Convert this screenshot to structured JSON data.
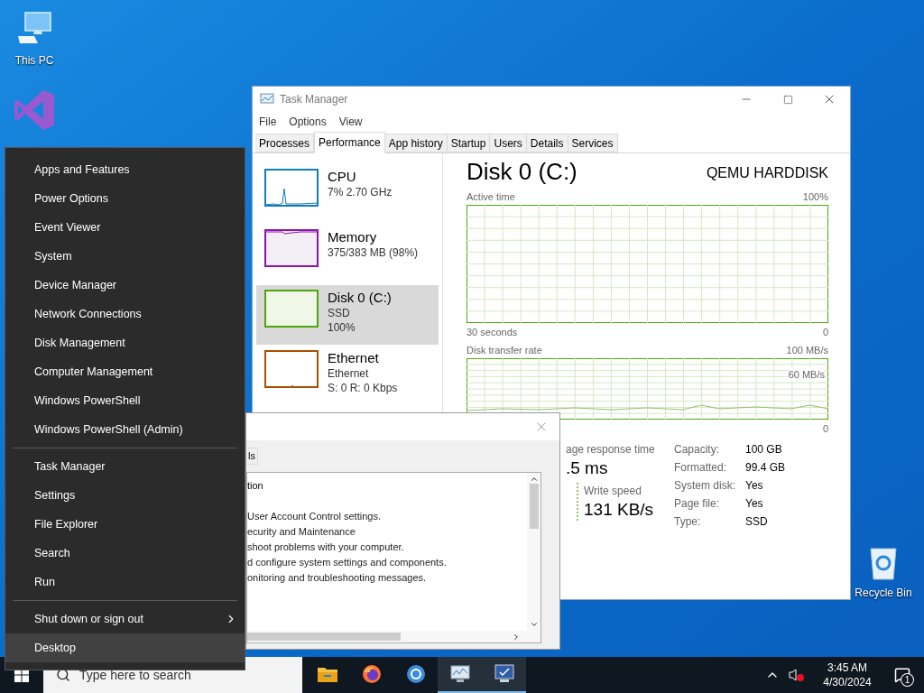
{
  "desktop_icons": [
    {
      "kind": "pc",
      "label": "This PC"
    },
    {
      "kind": "vs"
    },
    {
      "kind": "bin",
      "label": "Recycle Bin"
    }
  ],
  "task_manager": {
    "title": "Task Manager",
    "menu": [
      "File",
      "Options",
      "View"
    ],
    "tabs": [
      {
        "label": "Processes",
        "selected": false
      },
      {
        "label": "Performance",
        "selected": true
      },
      {
        "label": "App history",
        "selected": false
      },
      {
        "label": "Startup",
        "selected": false
      },
      {
        "label": "Users",
        "selected": false
      },
      {
        "label": "Details",
        "selected": false
      },
      {
        "label": "Services",
        "selected": false
      }
    ],
    "sidebar": [
      {
        "kind": "cpu",
        "title": "CPU",
        "lines": [
          "7% 2.70 GHz"
        ],
        "color": "#117dbb",
        "selected": false
      },
      {
        "kind": "memory",
        "title": "Memory",
        "lines": [
          "375/383 MB (98%)"
        ],
        "color": "#8b12ae",
        "selected": false
      },
      {
        "kind": "disk",
        "title": "Disk 0 (C:)",
        "lines": [
          "SSD",
          "100%"
        ],
        "color": "#4da60c",
        "selected": true
      },
      {
        "kind": "ethernet",
        "title": "Ethernet",
        "lines": [
          "Ethernet",
          "S: 0 R: 0 Kbps"
        ],
        "color": "#a74f01",
        "selected": false
      }
    ],
    "heading": "Disk 0 (C:)",
    "model": "QEMU HARDDISK",
    "active_chart": {
      "label": "Active time",
      "max": "100%",
      "span": "30 seconds",
      "min": "0"
    },
    "transfer_chart": {
      "label": "Disk transfer rate",
      "max": "100 MB/s",
      "mark": "60 MB/s",
      "min": "0"
    },
    "stats": [
      {
        "label": "age response time",
        "value": ".5 ms"
      },
      {
        "label": "Write speed",
        "value": "131 KB/s"
      }
    ],
    "properties": [
      {
        "label": "Capacity:",
        "value": "100 GB"
      },
      {
        "label": "Formatted:",
        "value": "99.4 GB"
      },
      {
        "label": "System disk:",
        "value": "Yes"
      },
      {
        "label": "Page file:",
        "value": "Yes"
      },
      {
        "label": "Type:",
        "value": "SSD"
      }
    ]
  },
  "dialog": {
    "tab": "ls",
    "header": "tion",
    "lines": [
      "User Account Control settings.",
      "ecurity and Maintenance",
      "shoot problems with your computer.",
      "d configure system settings and components.",
      "onitoring and troubleshooting messages."
    ]
  },
  "quick_menu": {
    "groups": [
      {
        "items": [
          {
            "label": "Apps and Features",
            "selected": false,
            "submenu": false
          },
          {
            "label": "Power Options",
            "selected": false,
            "submenu": false
          },
          {
            "label": "Event Viewer",
            "selected": false,
            "submenu": false
          },
          {
            "label": "System",
            "selected": false,
            "submenu": false
          },
          {
            "label": "Device Manager",
            "selected": false,
            "submenu": false
          },
          {
            "label": "Network Connections",
            "selected": false,
            "submenu": false
          },
          {
            "label": "Disk Management",
            "selected": false,
            "submenu": false
          },
          {
            "label": "Computer Management",
            "selected": false,
            "submenu": false
          },
          {
            "label": "Windows PowerShell",
            "selected": false,
            "submenu": false
          },
          {
            "label": "Windows PowerShell (Admin)",
            "selected": false,
            "submenu": false
          }
        ]
      },
      {
        "items": [
          {
            "label": "Task Manager",
            "selected": false,
            "submenu": false
          },
          {
            "label": "Settings",
            "selected": false,
            "submenu": false
          },
          {
            "label": "File Explorer",
            "selected": false,
            "submenu": false
          },
          {
            "label": "Search",
            "selected": false,
            "submenu": false
          },
          {
            "label": "Run",
            "selected": false,
            "submenu": false
          }
        ]
      },
      {
        "items": [
          {
            "label": "Shut down or sign out",
            "selected": false,
            "submenu": true
          },
          {
            "label": "Desktop",
            "selected": true,
            "submenu": false
          }
        ]
      }
    ]
  },
  "taskbar": {
    "search": {
      "placeholder": "Type here to search"
    },
    "apps": [
      {
        "kind": "folder",
        "running": false
      },
      {
        "kind": "firefox",
        "running": false
      },
      {
        "kind": "chrome",
        "running": false
      },
      {
        "kind": "monitor",
        "running": true
      },
      {
        "kind": "screen",
        "running": true
      }
    ],
    "time": "3:45 AM",
    "date": "4/30/2024",
    "notifications": "1"
  }
}
